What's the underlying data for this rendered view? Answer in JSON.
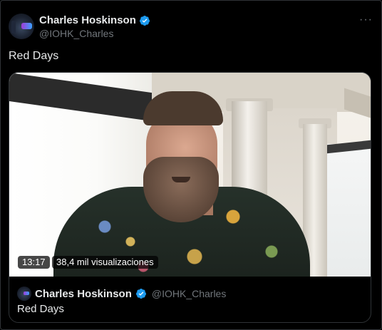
{
  "author": {
    "display_name": "Charles Hoskinson",
    "handle": "@IOHK_Charles",
    "verified": true,
    "avatar_icon": "avatar-robot-icon"
  },
  "more_menu": {
    "label": "···",
    "icon": "more-horizontal-icon"
  },
  "tweet": {
    "text": "Red Days"
  },
  "video": {
    "duration": "13:17",
    "views": "38,4 mil visualizaciones"
  },
  "quoted": {
    "display_name": "Charles Hoskinson",
    "handle": "@IOHK_Charles",
    "verified": true,
    "text": "Red Days"
  },
  "colors": {
    "background": "#000000",
    "text_primary": "#e7e9ea",
    "text_secondary": "#71767b",
    "verified_badge": "#1d9bf0",
    "border": "#2f3336"
  }
}
